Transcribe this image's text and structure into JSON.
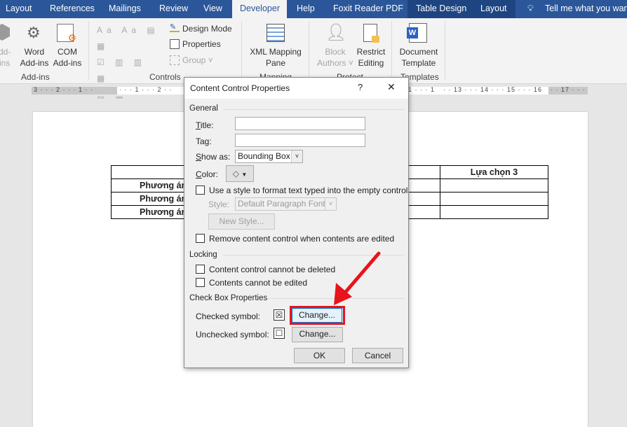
{
  "tabs": [
    {
      "label": "Layout"
    },
    {
      "label": "References"
    },
    {
      "label": "Mailings"
    },
    {
      "label": "Review"
    },
    {
      "label": "View"
    },
    {
      "label": "Developer",
      "active": true
    },
    {
      "label": "Help"
    },
    {
      "label": "Foxit Reader PDF"
    },
    {
      "label": "Table Design",
      "contextual": true
    },
    {
      "label": "Layout",
      "contextual": true
    }
  ],
  "tell_me": "Tell me what you want",
  "ribbon": {
    "addins": {
      "partial_label_1": "dd-",
      "partial_label_2": "ins",
      "word_line1": "Word",
      "word_line2": "Add-ins",
      "com_line1": "COM",
      "com_line2": "Add-ins",
      "group": "Add-ins"
    },
    "controls": {
      "design_mode": "Design Mode",
      "properties": "Properties",
      "group_btn": "Group",
      "group": "Controls"
    },
    "mapping": {
      "line1": "XML Mapping",
      "line2": "Pane",
      "group": "Mapping"
    },
    "protect": {
      "block_line1": "Block",
      "block_line2": "Authors",
      "restrict_line1": "Restrict",
      "restrict_line2": "Editing",
      "group": "Protect"
    },
    "templates": {
      "line1": "Document",
      "line2": "Template",
      "group": "Templates"
    }
  },
  "ruler": {
    "left": "3 · · · 2 · · · 1 · · ",
    "mid": "· · · 1 · · · 2 · ·",
    "right": "1 · · · 1",
    "right2": "· · 13 · · · 14 · · · 15 · · · 16",
    "right3": "· · 17 · · ·"
  },
  "table": {
    "header_col3": "Lựa chọn 3",
    "rows": [
      "Phương án",
      "Phương án",
      "Phương án"
    ]
  },
  "dialog": {
    "title": "Content Control Properties",
    "help": "?",
    "close": "✕",
    "general": "General",
    "title_label": "Title:",
    "title_value": "",
    "tag_label": "Tag:",
    "tag_value": "",
    "show_as_label": "Show as:",
    "show_as_value": "Bounding Box",
    "color_label": "Color:",
    "use_style": "Use a style to format text typed into the empty control",
    "use_style_checked": false,
    "style_label": "Style:",
    "style_value": "Default Paragraph Font",
    "new_style": "New Style...",
    "remove_cc": "Remove content control when contents are edited",
    "remove_cc_checked": false,
    "locking": "Locking",
    "cannot_delete": "Content control cannot be deleted",
    "cannot_delete_checked": false,
    "cannot_edit": "Contents cannot be edited",
    "cannot_edit_checked": false,
    "checkbox_props": "Check Box Properties",
    "checked_symbol_label": "Checked symbol:",
    "checked_symbol": "☒",
    "unchecked_symbol_label": "Unchecked symbol:",
    "unchecked_symbol": "☐",
    "change": "Change...",
    "ok": "OK",
    "cancel": "Cancel"
  },
  "colors": {
    "tabbar": "#2b579a",
    "contextual_tab": "#1e4582",
    "annotation": "#e8141b",
    "ribbon": "#f3f3f3"
  }
}
